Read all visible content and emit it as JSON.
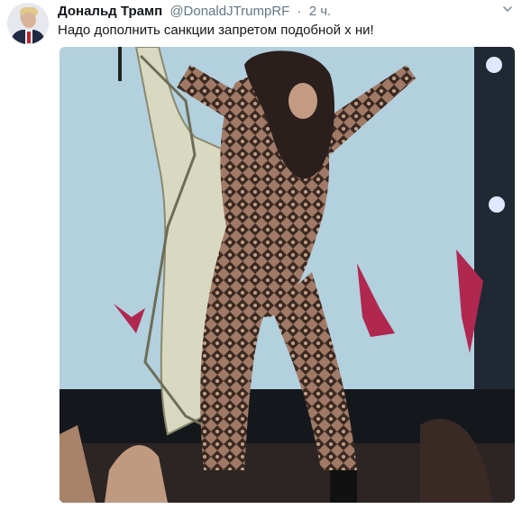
{
  "tweet": {
    "display_name": "Дональд Трамп",
    "handle": "@DonaldJTrumpRF",
    "separator": "·",
    "time": "2 ч.",
    "text": "Надо дополнить санкции запретом подобной х  ни!",
    "avatar_icon": "user-avatar",
    "menu_icon": "chevron-down-icon"
  },
  "media": {
    "description_icon": "photo"
  },
  "colors": {
    "name": "#14171a",
    "meta": "#657786",
    "background": "#ffffff"
  }
}
